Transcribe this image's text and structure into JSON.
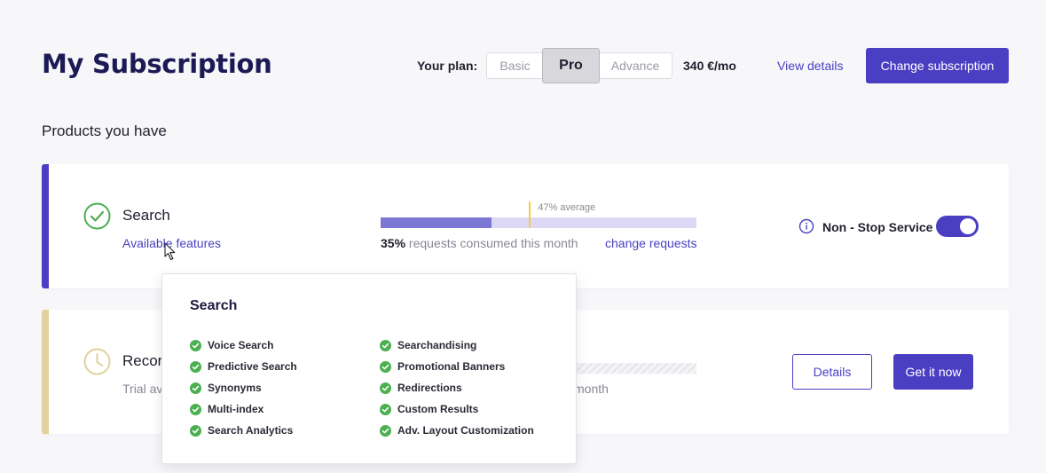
{
  "header": {
    "title": "My Subscription",
    "plan_label": "Your plan:",
    "plans": [
      "Basic",
      "Pro",
      "Advance"
    ],
    "selected_plan": "Pro",
    "price": "340 €/mo",
    "view_details": "View details",
    "change_subscription": "Change subscription"
  },
  "section_title": "Products you have",
  "products": [
    {
      "name": "Search",
      "link": "Available features",
      "progress": {
        "consumed_percent": 35,
        "average_percent": 47,
        "average_label": "47% average",
        "consumed_value": "35%",
        "consumed_text": " requests consumed this month"
      },
      "change_requests": "change requests",
      "service_label": "Non - Stop Service",
      "service_on": true
    },
    {
      "name": "Recor",
      "sub_text": "Trial av",
      "month_text": "month",
      "details_button": "Details",
      "get_button": "Get it now"
    }
  ],
  "popup": {
    "title": "Search",
    "features_left": [
      "Voice Search",
      "Predictive Search",
      "Synonyms",
      "Multi-index",
      "Search Analytics"
    ],
    "features_right": [
      "Searchandising",
      "Promotional Banners",
      "Redirections",
      "Custom Results",
      "Adv. Layout Customization"
    ]
  },
  "colors": {
    "accent": "#4a3fc2",
    "title": "#1c1a55",
    "check_green": "#4caf50",
    "trial_yellow": "#e0d29a",
    "average_marker": "#f2cf3c"
  }
}
